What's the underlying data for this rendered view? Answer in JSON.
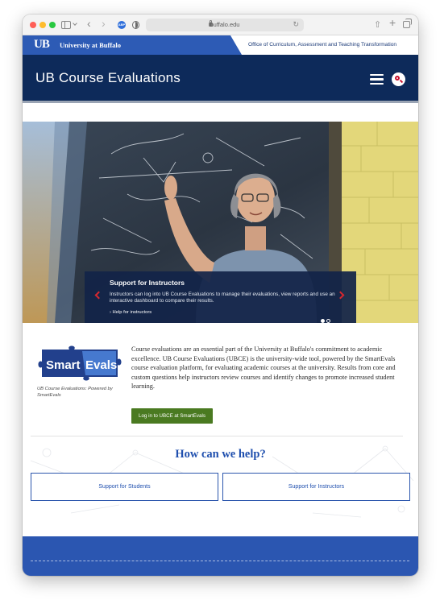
{
  "browser": {
    "url": "buffalo.edu",
    "extension_badge": "ABP"
  },
  "brand": {
    "ub_mark": "UB",
    "university_name": "University at Buffalo",
    "office_link": "Office of Curriculum, Assessment and Teaching Transformation"
  },
  "header": {
    "site_title": "UB Course Evaluations"
  },
  "hero": {
    "caption_title": "Support for Instructors",
    "caption_text": "Instructors can log into UB Course Evaluations to manage their evaluations, view reports and use an interactive dashboard to compare their results.",
    "caption_link": "Help for instructors",
    "slide_count": 2,
    "active_slide": 1
  },
  "intro": {
    "logo_text_a": "Smart",
    "logo_text_b": "Evals",
    "logo_caption": "UB Course Evaluations: Powered by SmartEvals",
    "body": "Course evaluations are an essential part of the University at Buffalo's commitment to academic excellence. UB Course Evaluations (UBCE) is the university-wide tool, powered by the SmartEvals course evaluation platform, for evaluating academic courses at the university. Results from core and custom questions help instructors review courses and identify changes to promote increased student learning.",
    "login_button": "Log in to UBCE at SmartEvals"
  },
  "help": {
    "title": "How can we help?",
    "students_button": "Support for Students",
    "instructors_button": "Support for Instructors"
  },
  "colors": {
    "ub_blue": "#2d5bb5",
    "header_navy": "#0d2a5a",
    "login_green": "#4a7a21",
    "accent_red": "#d6282f"
  }
}
